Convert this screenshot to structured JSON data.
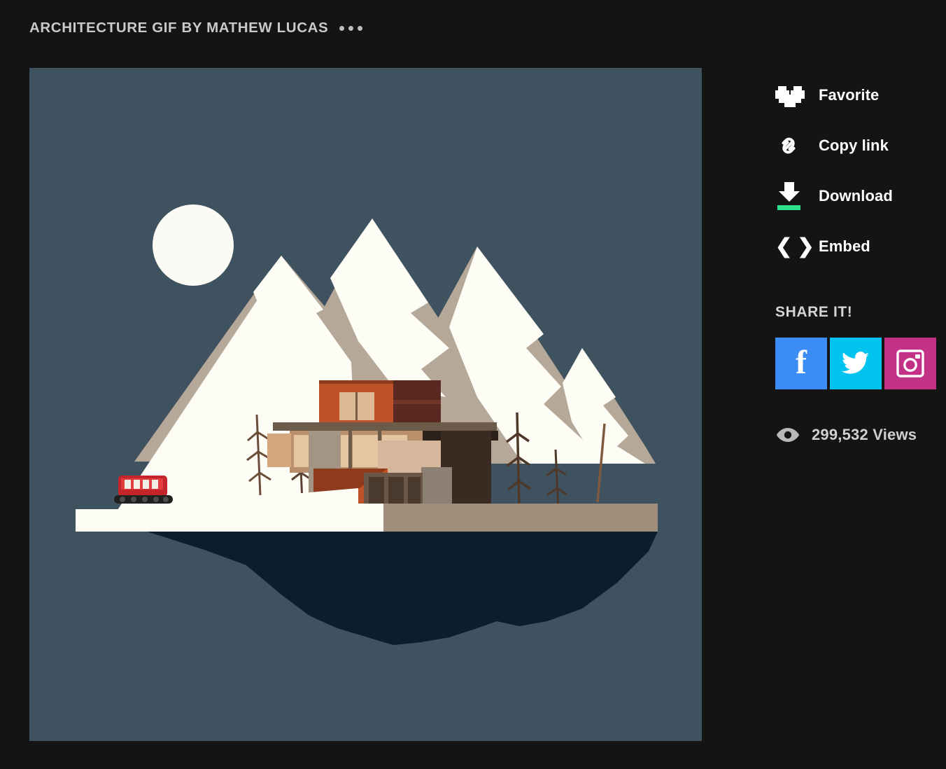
{
  "page": {
    "background_color": "#141414",
    "title": "ARCHITECTURE GIF BY MATHEW LUCAS",
    "more_menu_label": "•••"
  },
  "artwork": {
    "alt_name": "architecture-gif-floating-island-house",
    "background_color": "#3f5260",
    "sun_color": "#fbfaf4",
    "snow_color": "#fdfcf5",
    "rock_color": "#b5a899",
    "island_underside_color": "#0c1e2c",
    "vehicle_color": "#c4252b",
    "house_accent_color": "#c0522a"
  },
  "sidebar": {
    "actions": [
      {
        "label": "Favorite",
        "icon": "heart-icon"
      },
      {
        "label": "Copy link",
        "icon": "link-icon"
      },
      {
        "label": "Download",
        "icon": "download-icon",
        "accent_color": "#2fe08c"
      },
      {
        "label": "Embed",
        "icon": "code-brackets-icon"
      }
    ],
    "share": {
      "heading": "SHARE IT!",
      "buttons": [
        {
          "name": "facebook",
          "glyph": "f",
          "color": "#3b8cf5"
        },
        {
          "name": "twitter",
          "glyph": "twitter-bird-icon",
          "color": "#00c3f0"
        },
        {
          "name": "instagram",
          "glyph": "instagram-camera-icon",
          "color": "#c23186"
        }
      ]
    },
    "views": {
      "icon": "eye-icon",
      "count": "299,532",
      "label": "Views",
      "full_text": "299,532 Views"
    }
  }
}
